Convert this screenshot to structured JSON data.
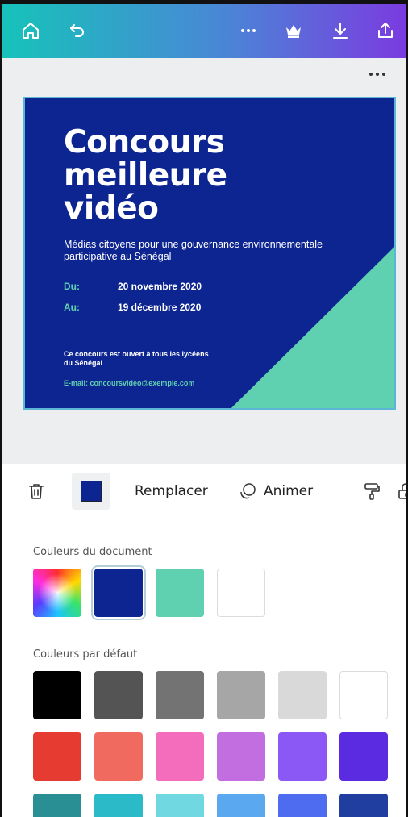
{
  "topbar": {
    "icons": [
      "home-icon",
      "undo-icon",
      "more-icon",
      "crown-icon",
      "download-icon",
      "share-icon"
    ]
  },
  "design": {
    "title": "Concours meilleure vidéo",
    "subtitle": "Médias citoyens pour une gouvernance environnementale participative au Sénégal",
    "from_label": "Du:",
    "from_date": "20 novembre 2020",
    "to_label": "Au:",
    "to_date": "19 décembre 2020",
    "note": "Ce concours est ouvert à tous les lycéens du Sénégal",
    "email": "E-mail: concoursvideo@exemple.com",
    "colors": {
      "background": "#0d2590",
      "accent": "#5fd0b0"
    }
  },
  "toolbar": {
    "color_value": "#0d2590",
    "replace_label": "Remplacer",
    "animate_label": "Animer"
  },
  "palette": {
    "document_title": "Couleurs du document",
    "document_colors": [
      "rainbow",
      "#0d2590",
      "#5fd0b0",
      "#ffffff"
    ],
    "default_title": "Couleurs par défaut",
    "default_colors_row1": [
      "#000000",
      "#545454",
      "#737373",
      "#a6a6a6",
      "#d9d9d9",
      "#ffffff"
    ],
    "default_colors_row2": [
      "#e63b30",
      "#f06a5f",
      "#f46dbd",
      "#c26ee0",
      "#8c58f5",
      "#5a2be0"
    ],
    "default_colors_row3": [
      "#2a8f95",
      "#2bbac8",
      "#6fd8e0",
      "#5aa9f0",
      "#4d6cf0",
      "#1f3ea0"
    ]
  }
}
